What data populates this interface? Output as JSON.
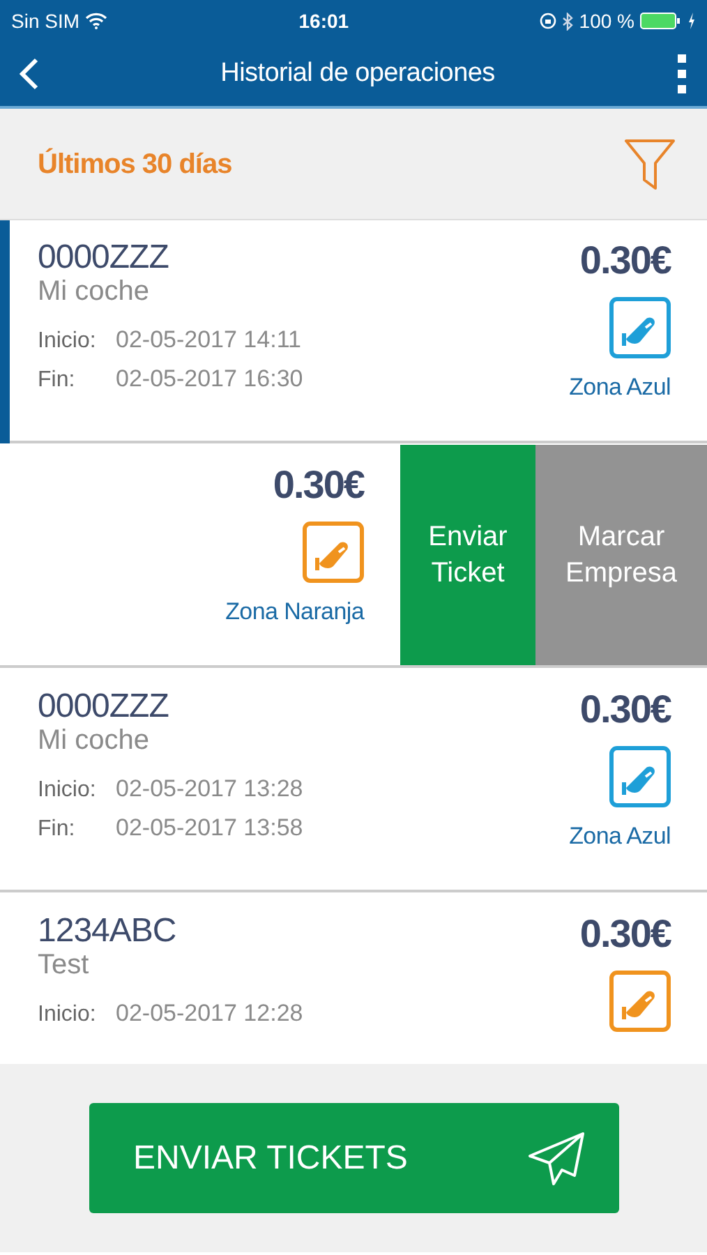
{
  "status_bar": {
    "carrier": "Sin SIM",
    "time": "16:01",
    "battery": "100 %"
  },
  "nav": {
    "title": "Historial de operaciones"
  },
  "filter": {
    "label": "Últimos 30 días"
  },
  "operations": [
    {
      "plate": "0000ZZZ",
      "name": "Mi coche",
      "start_label": "Inicio:",
      "start": "02-05-2017 14:11",
      "end_label": "Fin:",
      "end": "02-05-2017 16:30",
      "price": "0.30€",
      "zone": "Zona Azul",
      "color": "#1e9fd8",
      "selected": true,
      "swiped": false
    },
    {
      "price": "0.30€",
      "zone": "Zona Naranja",
      "color": "#f0931e",
      "selected": false,
      "swiped": true,
      "actions": [
        {
          "label": "Enviar Ticket",
          "kind": "send"
        },
        {
          "label": "Marcar Empresa",
          "kind": "company"
        }
      ]
    },
    {
      "plate": "0000ZZZ",
      "name": "Mi coche",
      "start_label": "Inicio:",
      "start": "02-05-2017 13:28",
      "end_label": "Fin:",
      "end": "02-05-2017 13:58",
      "price": "0.30€",
      "zone": "Zona Azul",
      "color": "#1e9fd8",
      "selected": false,
      "swiped": false
    },
    {
      "plate": "1234ABC",
      "name": "Test",
      "start_label": "Inicio:",
      "start": "02-05-2017 12:28",
      "price": "0.30€",
      "color": "#f0931e",
      "selected": false,
      "swiped": false
    }
  ],
  "send_button": {
    "label": "ENVIAR TICKETS"
  }
}
